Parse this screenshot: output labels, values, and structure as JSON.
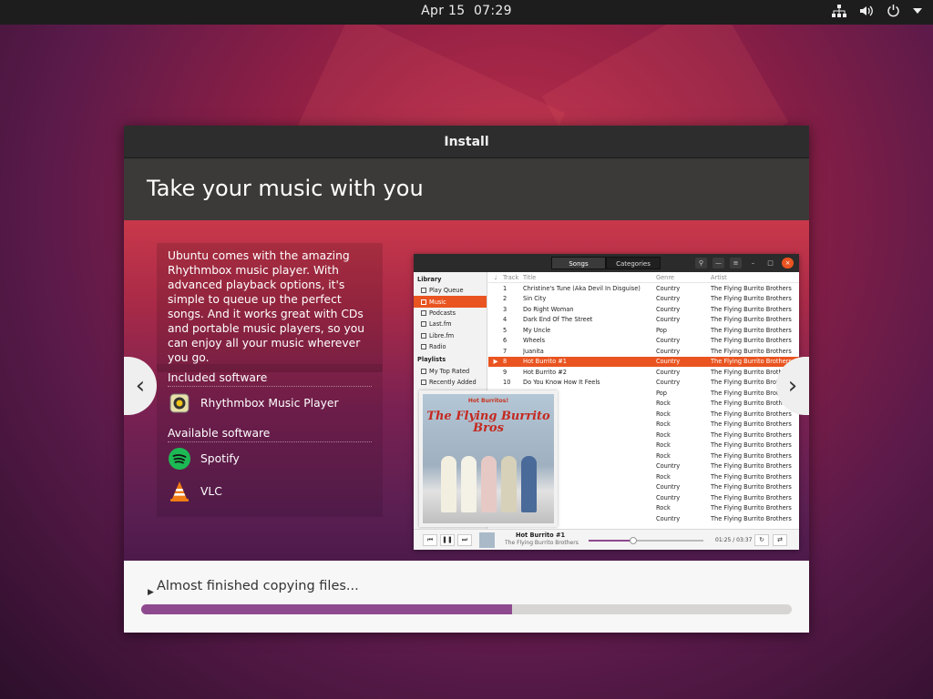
{
  "topbar": {
    "date": "Apr 15",
    "time": "07:29"
  },
  "window": {
    "title": "Install"
  },
  "slide": {
    "heading": "Take your music with you",
    "description": "Ubuntu comes with the amazing Rhythmbox music player. With advanced playback options, it's simple to queue up the perfect songs. And it works great with CDs and portable music players, so you can enjoy all your music wherever you go.",
    "included_label": "Included software",
    "included": [
      {
        "name": "Rhythmbox Music Player",
        "icon": "rhythmbox-icon"
      }
    ],
    "available_label": "Available software",
    "available": [
      {
        "name": "Spotify",
        "icon": "spotify-icon"
      },
      {
        "name": "VLC",
        "icon": "vlc-icon"
      }
    ]
  },
  "rhythmbox": {
    "tabs": [
      "Songs",
      "Categories"
    ],
    "library_header": "Library",
    "library": [
      "Play Queue",
      "Music",
      "Podcasts",
      "Last.fm",
      "Libre.fm",
      "Radio"
    ],
    "playlists_header": "Playlists",
    "playlists": [
      "My Top Rated",
      "Recently Added"
    ],
    "columns": [
      "Track",
      "Title",
      "Genre",
      "Artist"
    ],
    "tracks": [
      [
        "1",
        "Christine's Tune (Aka Devil In Disguise)",
        "Country",
        "The Flying Burrito Brothers"
      ],
      [
        "2",
        "Sin City",
        "Country",
        "The Flying Burrito Brothers"
      ],
      [
        "3",
        "Do Right Woman",
        "Country",
        "The Flying Burrito Brothers"
      ],
      [
        "4",
        "Dark End Of The Street",
        "Country",
        "The Flying Burrito Brothers"
      ],
      [
        "5",
        "My Uncle",
        "Pop",
        "The Flying Burrito Brothers"
      ],
      [
        "6",
        "Wheels",
        "Country",
        "The Flying Burrito Brothers"
      ],
      [
        "7",
        "Juanita",
        "Country",
        "The Flying Burrito Brothers"
      ],
      [
        "8",
        "Hot Burrito #1",
        "Country",
        "The Flying Burrito Brothers"
      ],
      [
        "9",
        "Hot Burrito #2",
        "Country",
        "The Flying Burrito Broth"
      ],
      [
        "10",
        "Do You Know How It Feels",
        "Country",
        "The Flying Burrito Brothers"
      ],
      [
        "",
        "",
        "Pop",
        "The Flying Burrito Broth"
      ],
      [
        "",
        "ng",
        "Rock",
        "The Flying Burrito Brothe"
      ],
      [
        "",
        "",
        "Rock",
        "The Flying Burrito Brothers"
      ],
      [
        "",
        "e",
        "Rock",
        "The Flying Burrito Brothers"
      ],
      [
        "",
        "n Queen",
        "Rock",
        "The Flying Burrito Brothers"
      ],
      [
        "",
        "Go",
        "Rock",
        "The Flying Burrito Brothers"
      ],
      [
        "",
        "Fog",
        "Rock",
        "The Flying Burrito Brothers"
      ],
      [
        "",
        "g",
        "Country",
        "The Flying Burrito Brothers"
      ],
      [
        "",
        "",
        "Rock",
        "The Flying Burrito Brothers"
      ],
      [
        "",
        "",
        "Country",
        "The Flying Burrito Brothers"
      ],
      [
        "",
        "Singer",
        "Country",
        "The Flying Burrito Brothers"
      ],
      [
        "",
        "Churchyard",
        "Rock",
        "The Flying Burrito Brothers"
      ],
      [
        "",
        "",
        "Country",
        "The Flying Burrito Brothers"
      ]
    ],
    "selected_index": 7,
    "album_small": "Hot Burritos!",
    "album_big": "The Flying Burrito Bros",
    "now_playing_title": "Hot Burrito #1",
    "now_playing_artist": "The Flying Burrito Brothers",
    "time_display": "01:25 / 03:37",
    "seek_fraction": 0.39
  },
  "status": {
    "text": "Almost finished copying files...",
    "progress": 0.57
  },
  "colors": {
    "accent": "#e95420",
    "progress": "#8e4a8e"
  }
}
